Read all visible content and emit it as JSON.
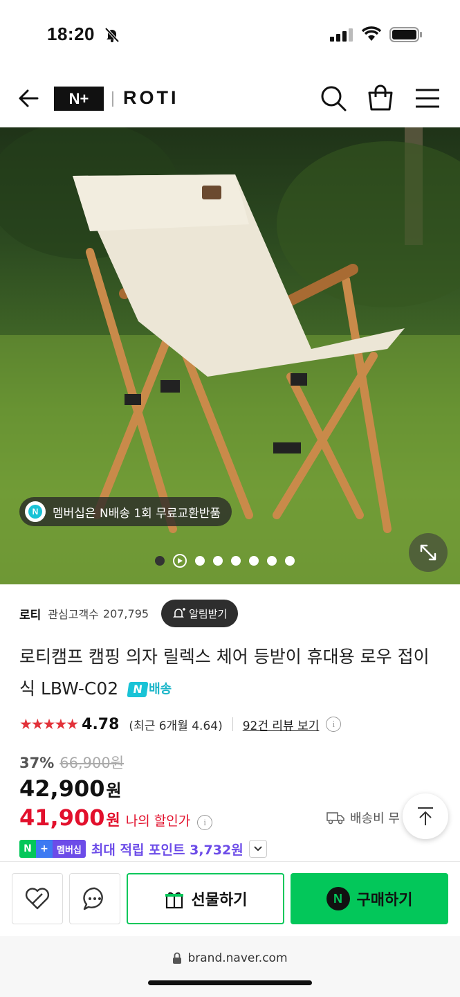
{
  "status_bar": {
    "time": "18:20"
  },
  "header": {
    "logo_text": "N+",
    "brand": "ROTI"
  },
  "hero": {
    "membership_banner": "멤버십은 N배송 1회 무료교환반품",
    "dot_count": 8
  },
  "store": {
    "name": "로티",
    "follower_label": "관심고객수",
    "follower_count": "207,795",
    "notify_label": "알림받기"
  },
  "product": {
    "title": "로티캠프 캠핑 의자 릴렉스 체어 등받이 휴대용 로우 접이식 LBW-C02",
    "delivery_badge": "N",
    "delivery_label": "배송"
  },
  "rating": {
    "stars": "★★★★★",
    "value": "4.78",
    "recent": "(최근 6개월 4.64)",
    "review_link": "92건 리뷰 보기"
  },
  "pricing": {
    "discount_rate": "37%",
    "original_price": "66,900원",
    "price": "42,900",
    "price_unit": "원",
    "my_price": "41,900",
    "my_price_unit": "원",
    "my_price_label": "나의 할인가",
    "shipping_label": "배송비 무"
  },
  "points": {
    "badge_n": "N",
    "badge_plus": "+",
    "badge_member": "멤버십",
    "text": "최대 적립 포인트 3,732원"
  },
  "actions": {
    "gift_label": "선물하기",
    "buy_badge": "N",
    "buy_label": "구매하기"
  },
  "browser": {
    "url": "brand.naver.com"
  },
  "colors": {
    "naver_green": "#03c75a",
    "discount_red": "#e2102c",
    "membership_purple": "#6c4ce8"
  }
}
